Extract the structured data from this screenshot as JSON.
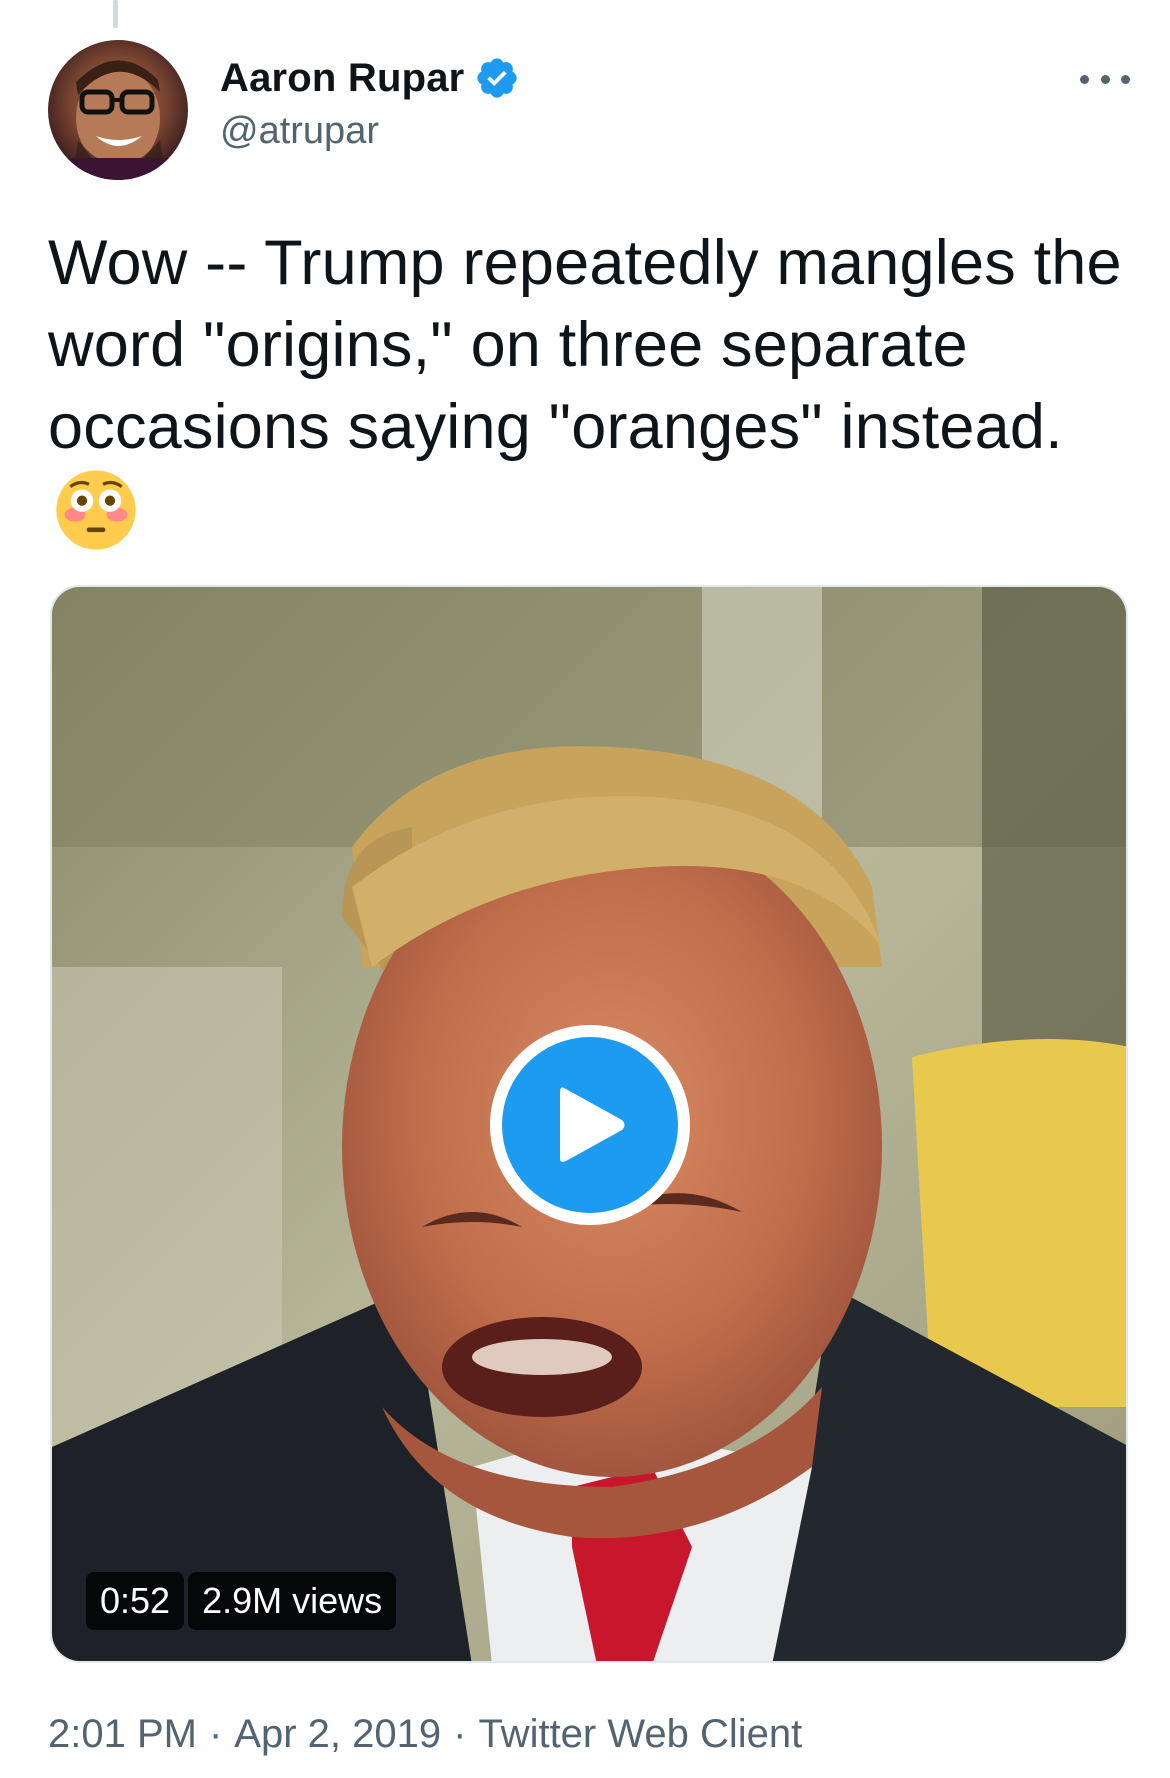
{
  "author": {
    "display_name": "Aaron Rupar",
    "handle": "@atrupar",
    "verified": true
  },
  "tweet": {
    "text": "Wow -- Trump repeatedly mangles the word \"origins,\" on three separate occasions saying \"oranges\" instead.",
    "emoji": "flushed-face"
  },
  "video": {
    "duration": "0:52",
    "views": "2.9M views"
  },
  "meta": {
    "time": "2:01 PM",
    "date": "Apr 2, 2019",
    "client": "Twitter Web Client",
    "separator": "·"
  },
  "colors": {
    "verified_blue": "#1d9bf0",
    "secondary_text": "#536471"
  }
}
